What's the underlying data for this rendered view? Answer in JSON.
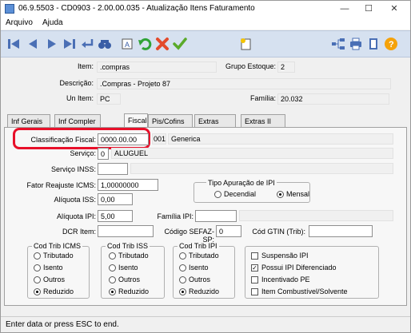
{
  "window": {
    "title": "06.9.5503 - CD0903 - 2.00.00.035 - Atualização Itens Faturamento",
    "minimize": "—",
    "maximize": "☐",
    "close": "✕"
  },
  "menu": {
    "file": "Arquivo",
    "help": "Ajuda"
  },
  "header": {
    "item_label": "Item:",
    "item_value": ".compras",
    "grupo_label": "Grupo Estoque:",
    "grupo_value": "2",
    "descricao_label": "Descrição:",
    "descricao_value": ".Compras - Projeto 87",
    "un_label": "Un Item:",
    "un_value": "PC",
    "familia_label": "Família:",
    "familia_value": "20.032"
  },
  "tabs": [
    "Inf Gerais",
    "Inf Compler",
    "Fiscal",
    "Pis/Cofins",
    "Extras",
    "Extras II"
  ],
  "fiscal": {
    "classificacao_label": "Classificação Fiscal:",
    "classificacao_value": "0000.00.00",
    "classificacao_code": "001",
    "classificacao_desc": "Generica",
    "servico_label": "Serviço:",
    "servico_value": "0",
    "servico_desc": "ALUGUEL",
    "servico_inss_label": "Serviço INSS:",
    "servico_inss_value": "",
    "fator_label": "Fator Reajuste ICMS:",
    "fator_value": "1,00000000",
    "aliq_iss_label": "Alíquota ISS:",
    "aliq_iss_value": "0,00",
    "aliq_ipi_label": "Alíquota IPI:",
    "aliq_ipi_value": "5,00",
    "familia_ipi_label": "Família IPI:",
    "familia_ipi_value": "",
    "dcr_label": "DCR Item:",
    "dcr_value": "",
    "sefaz_label": "Código SEFAZ-SP:",
    "sefaz_value": "0",
    "gtin_label": "Cód GTIN (Trib):",
    "gtin_value": "",
    "tipo_apuracao_label": "Tipo Apuração de IPI",
    "decendial": "Decendial",
    "mensal": "Mensal"
  },
  "groups": {
    "icms": {
      "title": "Cod Trib ICMS",
      "options": [
        "Tributado",
        "Isento",
        "Outros",
        "Reduzido"
      ],
      "selected": "Reduzido"
    },
    "iss": {
      "title": "Cod Trib ISS",
      "options": [
        "Tributado",
        "Isento",
        "Outros",
        "Reduzido"
      ],
      "selected": "Reduzido"
    },
    "ipi": {
      "title": "Cod Trib IPI",
      "options": [
        "Tributado",
        "Isento",
        "Outros",
        "Reduzido"
      ],
      "selected": "Reduzido"
    }
  },
  "checks": {
    "suspensao": "Suspensão IPI",
    "possui": "Possui IPI Diferenciado",
    "incentivado": "Incentivado PE",
    "combustivel": "Item Combustível/Solvente"
  },
  "status": "Enter data or press ESC to end.",
  "colors": {
    "toolbar": "#d6e1f0",
    "highlight": "#e8102a",
    "nav_blue": "#4a6fb5"
  }
}
